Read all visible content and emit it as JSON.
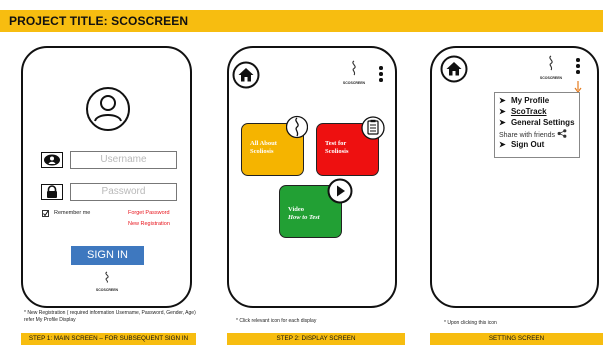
{
  "project_title": "PROJECT TITLE: SCOSCREEN",
  "brand": "SCOSCREEN",
  "screen1": {
    "username_placeholder": "Username",
    "password_placeholder": "Password",
    "remember_me": "Remember me",
    "forgot_password": "Forget Password",
    "new_registration": "New Registration",
    "sign_in": "SIGN IN",
    "note": "* New Registration ( required information Username, Password, Gender, Age) refer My Profile Display",
    "caption": "STEP 1: MAIN SCREEN – FOR SUBSEQUENT SIGN IN"
  },
  "screen2": {
    "tiles": [
      {
        "line1": "All About",
        "line2": "Scoliosis",
        "color": "#f5b400"
      },
      {
        "line1": "Test for",
        "line2": "Scoliosis",
        "color": "#ee1010"
      },
      {
        "line1": "Video",
        "line2": "How to Test",
        "color": "#22a034"
      }
    ],
    "note": "* Click relevant icon for each display",
    "caption": "STEP 2: DISPLAY SCREEN"
  },
  "screen3": {
    "menu": [
      "My Profile",
      "ScoTrack",
      "General Settings",
      "Share with friends",
      "Sign Out"
    ],
    "note": "* Upon clicking this icon",
    "caption": "SETTING SCREEN"
  },
  "colors": {
    "accent": "#f7bd10",
    "sign_in_button": "#3e78bf",
    "link_red": "#e8141c",
    "arrow_orange": "#e47b1e"
  }
}
